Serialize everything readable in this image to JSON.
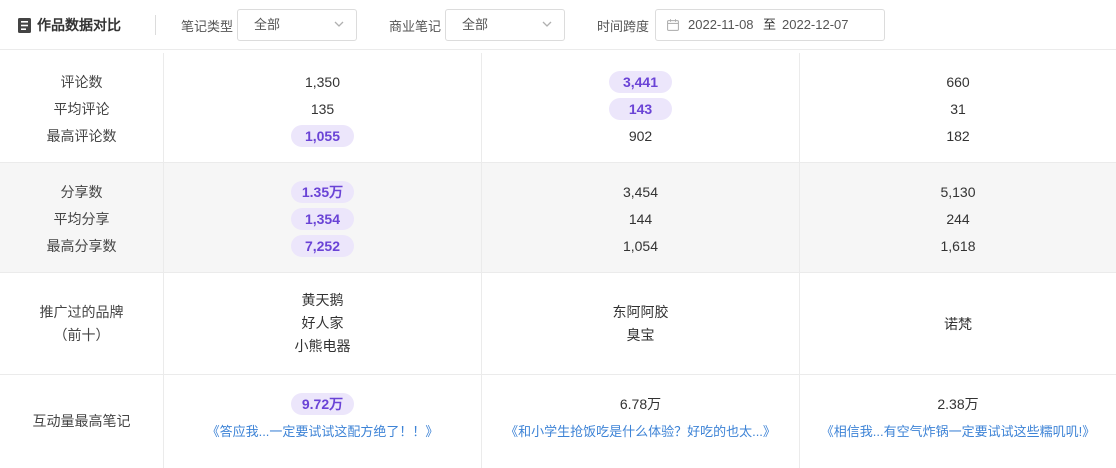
{
  "toolbar": {
    "title": "作品数据对比",
    "note_type_label": "笔记类型",
    "note_type_value": "全部",
    "business_label": "商业笔记",
    "business_value": "全部",
    "time_label": "时间跨度",
    "date_start": "2022-11-08",
    "date_sep": "至",
    "date_end": "2022-12-07"
  },
  "rows": {
    "comments": {
      "labels": [
        "评论数",
        "平均评论",
        "最高评论数"
      ],
      "col1": [
        "1,350",
        "135",
        "1,055"
      ],
      "col2": [
        "3,441",
        "143",
        "902"
      ],
      "col3": [
        "660",
        "31",
        "182"
      ]
    },
    "shares": {
      "labels": [
        "分享数",
        "平均分享",
        "最高分享数"
      ],
      "col1": [
        "1.35万",
        "1,354",
        "7,252"
      ],
      "col2": [
        "3,454",
        "144",
        "1,054"
      ],
      "col3": [
        "5,130",
        "244",
        "1,618"
      ]
    },
    "brands": {
      "labels": [
        "推广过的品牌",
        "（前十）"
      ],
      "col1": [
        "黄天鹅",
        "好人家",
        "小熊电器"
      ],
      "col2": [
        "东阿阿胶",
        "臭宝"
      ],
      "col3": [
        "诺梵"
      ]
    },
    "top_note": {
      "label": "互动量最高笔记",
      "col1_value": "9.72万",
      "col1_title": "《答应我...一定要试试这配方绝了！！》",
      "col2_value": "6.78万",
      "col2_title": "《和小学生抢饭吃是什么体验？好吃的也太...》",
      "col3_value": "2.38万",
      "col3_title": "《相信我...有空气炸锅一定要试试这些糯叽叽!》"
    }
  },
  "colors": {
    "highlight_bg": "#ece6fb",
    "highlight_text": "#6a43d6",
    "link": "#3d83d6"
  },
  "icons": {
    "title": "document-icon",
    "select": "chevron-down-icon",
    "date": "calendar-icon"
  }
}
